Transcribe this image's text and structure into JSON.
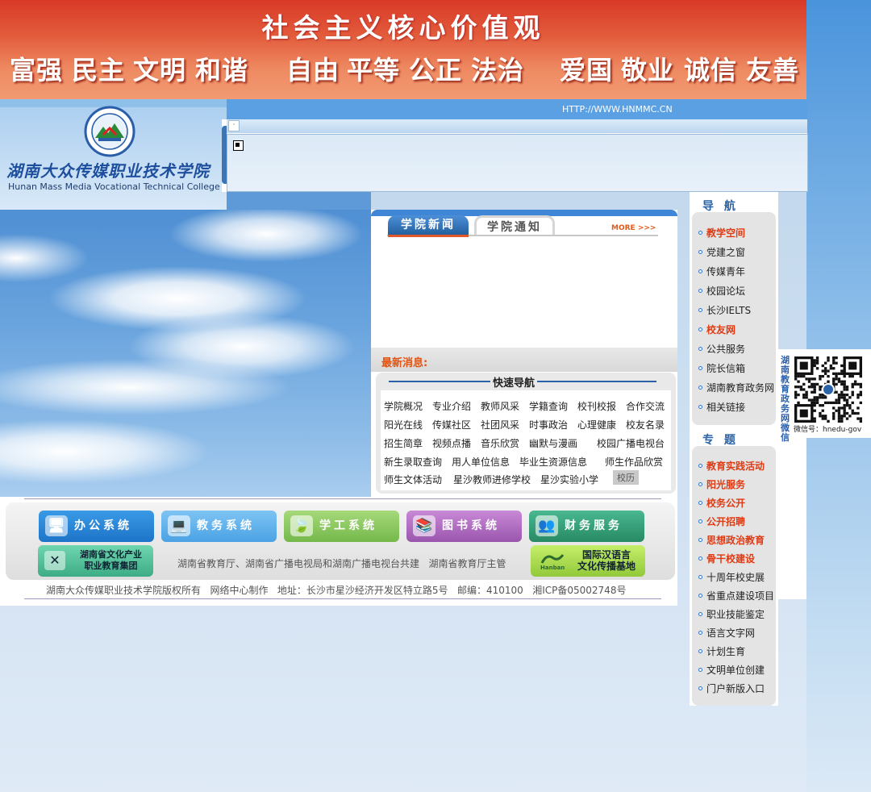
{
  "banner": {
    "title": "社会主义核心价值观",
    "values": [
      "富强",
      "民主",
      "文明",
      "和谐",
      "自由",
      "平等",
      "公正",
      "法治",
      "爱国",
      "敬业",
      "诚信",
      "友善"
    ]
  },
  "header": {
    "url": "HTTP://WWW.HNMMC.CN",
    "college_name_cn": "湖南大众传媒职业技术学院",
    "college_name_en": "Hunan Mass Media Vocational Technical College",
    "marquee_dot": "·"
  },
  "news": {
    "tabs": [
      "学院新闻",
      "学院通知"
    ],
    "more": "MORE >>>",
    "latest_label": "最新消息:"
  },
  "quick_nav": {
    "title": "快速导航",
    "rows": [
      [
        "学院概况",
        "专业介绍",
        "教师风采",
        "学籍查询",
        "校刊校报",
        "合作交流"
      ],
      [
        "阳光在线",
        "传媒社区",
        "社团风采",
        "时事政治",
        "心理健康",
        "校友名录"
      ],
      [
        "招生简章",
        "视频点播",
        "音乐欣赏",
        "幽默与漫画",
        "校园广播电视台"
      ],
      [
        "新生录取查询",
        "用人单位信息",
        "毕业生资源信息",
        "师生作品欣赏"
      ],
      [
        "师生文体活动",
        "星沙教师进修学校",
        "星沙实验小学",
        "校历"
      ]
    ]
  },
  "systems": {
    "office": "办公系统",
    "edu": "教务系统",
    "xuegong": "学工系统",
    "library": "图书系统",
    "finance": "财务服务",
    "culture_line1": "湖南省文化产业",
    "culture_line2": "职业教育集团",
    "hanban_line1": "国际汉语言",
    "hanban_line2": "文化传播基地",
    "hanban_logo": "Hanban"
  },
  "footer": {
    "cosponsor": "湖南省教育厅、湖南省广播电视局和湖南广播电视台共建   湖南省教育厅主管",
    "copyright": "湖南大众传媒职业技术学院版权所有   网络中心制作   地址：长沙市星沙经济开发区特立路5号   邮编：410100   湘ICP备05002748号"
  },
  "sidebar": {
    "nav_title": "导 航",
    "nav_items": [
      {
        "label": "教学空间",
        "hot": true
      },
      {
        "label": "党建之窗",
        "hot": false
      },
      {
        "label": "传媒青年",
        "hot": false
      },
      {
        "label": "校园论坛",
        "hot": false
      },
      {
        "label": "长沙IELTS",
        "hot": false
      },
      {
        "label": "校友网",
        "hot": true
      },
      {
        "label": "公共服务",
        "hot": false
      },
      {
        "label": "院长信箱",
        "hot": false
      },
      {
        "label": "湖南教育政务网",
        "hot": false
      },
      {
        "label": "相关链接",
        "hot": false
      }
    ],
    "topic_title": "专 题",
    "topic_items": [
      {
        "label": "教育实践活动",
        "hot": true
      },
      {
        "label": "阳光服务",
        "hot": true
      },
      {
        "label": "校务公开",
        "hot": true
      },
      {
        "label": "公开招聘",
        "hot": true
      },
      {
        "label": "思想政治教育",
        "hot": true
      },
      {
        "label": "骨干校建设",
        "hot": true
      },
      {
        "label": "十周年校史展",
        "hot": false
      },
      {
        "label": "省重点建设项目",
        "hot": false
      },
      {
        "label": "职业技能鉴定",
        "hot": false
      },
      {
        "label": "语言文字网",
        "hot": false
      },
      {
        "label": "计划生育",
        "hot": false
      },
      {
        "label": "文明单位创建",
        "hot": false
      },
      {
        "label": "门户新版入口",
        "hot": false
      }
    ]
  },
  "qr": {
    "vertical_text": "湖南教育政务网微信",
    "caption": "微信号：hnedu-gov"
  },
  "colors": {
    "banner_red": "#d93a28",
    "accent_blue": "#2b63a8",
    "hot_red": "#e03a12"
  }
}
